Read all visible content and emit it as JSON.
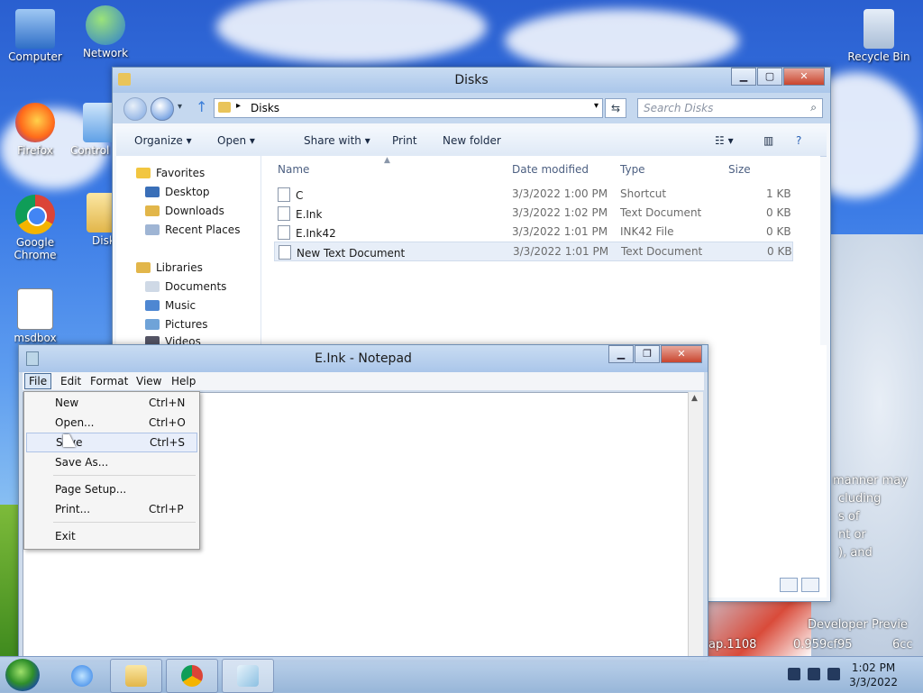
{
  "desktop": {
    "icons": [
      {
        "label": "Computer"
      },
      {
        "label": "Network"
      },
      {
        "label": "Recycle Bin"
      },
      {
        "label": "Firefox"
      },
      {
        "label": "Control"
      },
      {
        "label": "Google Chrome"
      },
      {
        "label": "Disks"
      },
      {
        "label": "msdbox"
      }
    ],
    "watermark": [
      "manner may",
      "cluding",
      "s of",
      "nt or",
      "), and",
      "Developer Previe",
      "ap.1108",
      "0.959cf95",
      "6cc"
    ]
  },
  "explorer": {
    "title": "Disks",
    "address": "Disks",
    "search_placeholder": "Search Disks",
    "toolbar": {
      "organize": "Organize",
      "open": "Open",
      "share_with": "Share with",
      "print": "Print",
      "new_folder": "New folder"
    },
    "nav": {
      "favorites": "Favorites",
      "favorites_items": [
        "Desktop",
        "Downloads",
        "Recent Places"
      ],
      "libraries": "Libraries",
      "libraries_items": [
        "Documents",
        "Music",
        "Pictures",
        "Videos"
      ]
    },
    "columns": {
      "name": "Name",
      "date": "Date modified",
      "type": "Type",
      "size": "Size"
    },
    "files": [
      {
        "name": "C",
        "date": "3/3/2022 1:00 PM",
        "type": "Shortcut",
        "size": "1 KB"
      },
      {
        "name": "E.Ink",
        "date": "3/3/2022 1:02 PM",
        "type": "Text Document",
        "size": "0 KB"
      },
      {
        "name": "E.Ink42",
        "date": "3/3/2022 1:01 PM",
        "type": "INK42 File",
        "size": "0 KB"
      },
      {
        "name": "New Text Document",
        "date": "3/3/2022 1:01 PM",
        "type": "Text Document",
        "size": "0 KB"
      }
    ]
  },
  "notepad": {
    "title": "E.Ink - Notepad",
    "menu": [
      "File",
      "Edit",
      "Format",
      "View",
      "Help"
    ],
    "file_menu": [
      {
        "label": "New",
        "shortcut": "Ctrl+N"
      },
      {
        "label": "Open...",
        "shortcut": "Ctrl+O"
      },
      {
        "label": "Save",
        "shortcut": "Ctrl+S"
      },
      {
        "label": "Save As...",
        "shortcut": ""
      },
      {
        "label": "Page Setup...",
        "shortcut": ""
      },
      {
        "label": "Print...",
        "shortcut": "Ctrl+P"
      },
      {
        "label": "Exit",
        "shortcut": ""
      }
    ]
  },
  "taskbar": {
    "time": "1:02 PM",
    "date": "3/3/2022"
  },
  "colors": {
    "accent": "#3b7be6",
    "selection": "#e7eef8",
    "close": "#c9452e"
  }
}
